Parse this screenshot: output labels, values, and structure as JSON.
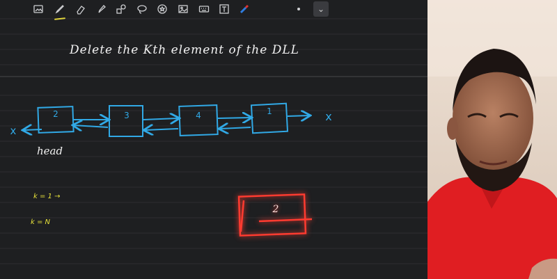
{
  "toolbar": {
    "tools": [
      "image-icon",
      "pen-icon",
      "eraser-icon",
      "highlighter-icon",
      "shapes-icon",
      "lasso-icon",
      "sticker-icon",
      "photo-icon",
      "keyboard-icon",
      "text-icon",
      "color-picker-icon"
    ],
    "active_tool": "pen-icon",
    "dropdown_glyph": "⌄"
  },
  "note": {
    "title": "Delete the Kth element of the DLL",
    "list_nodes": [
      "2",
      "3",
      "4",
      "1"
    ],
    "null_left": "x",
    "null_right": "x",
    "head_label": "head",
    "k_first": "k = 1  →",
    "k_last": "k = N",
    "highlight_value": "2"
  },
  "colors": {
    "canvas": "#1e1f21",
    "ink_white": "#f2f2f2",
    "ink_blue": "#31a9e6",
    "ink_yellow": "#e6e13a",
    "ink_red": "#ff3b30",
    "shirt_red": "#e01e22"
  }
}
